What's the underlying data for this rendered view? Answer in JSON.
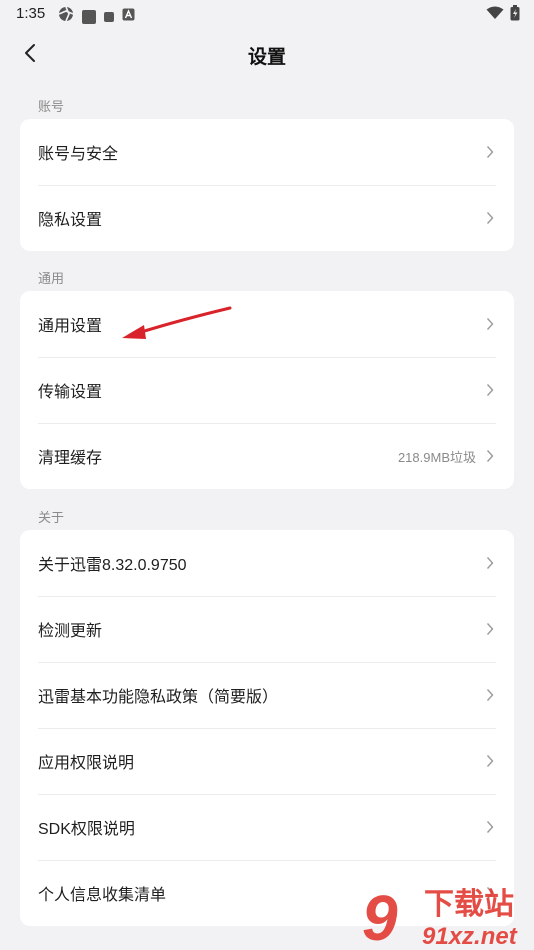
{
  "status_bar": {
    "time": "1:35",
    "icons_left": [
      "aperture-icon",
      "app-square-icon",
      "small-square-icon",
      "a-box-icon"
    ],
    "icons_right": [
      "wifi-icon",
      "battery-icon"
    ]
  },
  "header": {
    "title": "设置"
  },
  "sections": [
    {
      "label": "账号",
      "items": [
        {
          "label": "账号与安全"
        },
        {
          "label": "隐私设置"
        }
      ]
    },
    {
      "label": "通用",
      "items": [
        {
          "label": "通用设置"
        },
        {
          "label": "传输设置"
        },
        {
          "label": "清理缓存",
          "value": "218.9MB垃圾"
        }
      ]
    },
    {
      "label": "关于",
      "items": [
        {
          "label": "关于迅雷8.32.0.9750"
        },
        {
          "label": "检测更新"
        },
        {
          "label": "迅雷基本功能隐私政策（简要版）"
        },
        {
          "label": "应用权限说明"
        },
        {
          "label": "SDK权限说明"
        },
        {
          "label": "个人信息收集清单"
        }
      ]
    }
  ],
  "watermark": {
    "brand": "下载站",
    "domain": "91xz.net",
    "mark": "9"
  },
  "colors": {
    "background": "#f2f2f4",
    "card": "#ffffff",
    "annotation_arrow": "#d9232a",
    "watermark": "#e23a32"
  }
}
